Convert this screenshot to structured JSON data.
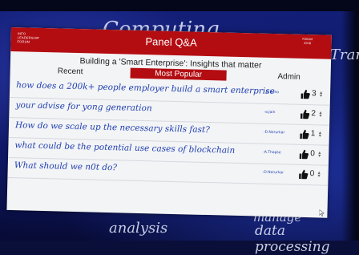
{
  "backdrop": {
    "words": [
      "Computing",
      "Trans",
      "analysis",
      "manage",
      "data processing"
    ]
  },
  "panel": {
    "title": "Panel Q&A",
    "logo_left": [
      "INFO",
      "LEADERSHIP",
      "FORUM"
    ],
    "logo_right": [
      "FORUM",
      "2018"
    ],
    "subtitle": "Building a 'Smart Enterprise': Insights that matter",
    "tabs": {
      "recent": "Recent",
      "popular": "Most Popular",
      "admin": "Admin"
    },
    "questions": [
      {
        "text": "how does a 200k+ people employer build a smart enterprise",
        "by": "-D.Bono",
        "votes": "3"
      },
      {
        "text": "your advise for yong generation",
        "by": "-a.Jain",
        "votes": "2"
      },
      {
        "text": "How do we scale up the necessary skills fast?",
        "by": "-D.Nerurkar",
        "votes": "1"
      },
      {
        "text": "what could be the potential use cases of blockchain",
        "by": "-A.Thapse",
        "votes": "0"
      },
      {
        "text": "What should we n0t do?",
        "by": "-D.Nerurkar",
        "votes": "0"
      }
    ]
  },
  "colors": {
    "header": "#b30d12",
    "question_text": "#1f3fb0",
    "panel_bg": "#f3f4f6"
  }
}
